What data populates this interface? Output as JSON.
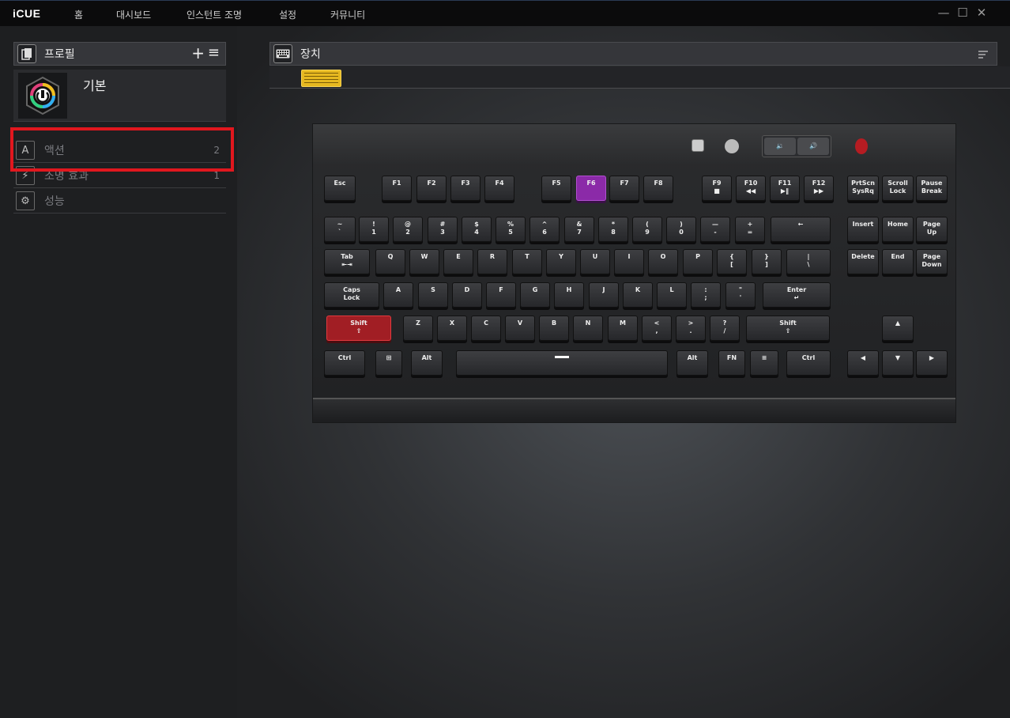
{
  "app": {
    "title": "iCUE"
  },
  "nav": [
    {
      "label": "홈"
    },
    {
      "label": "대시보드"
    },
    {
      "label": "인스턴트 조명"
    },
    {
      "label": "설정"
    },
    {
      "label": "커뮤니티"
    }
  ],
  "window": {
    "minimize": "—",
    "maximize": "☐",
    "close": "✕"
  },
  "profiles": {
    "title": "프로필",
    "add": "+",
    "menu": "≡",
    "active": {
      "name": "기본"
    }
  },
  "sections": [
    {
      "icon": "A",
      "label": "액션",
      "count": "2"
    },
    {
      "icon": "⚡",
      "label": "조명 효과",
      "count": "1"
    },
    {
      "icon": "⚙",
      "label": "성능",
      "count": ""
    }
  ],
  "devices": {
    "title": "장치"
  },
  "keyboard": {
    "rows": [
      [
        "Esc",
        "F1",
        "F2",
        "F3",
        "F4",
        "F5",
        "F6",
        "F7",
        "F8",
        "F9\n■",
        "F10\n◀◀",
        "F11\n▶‖",
        "F12\n▶▶",
        "PrtScn\nSysRq",
        "Scroll\nLock",
        "Pause\nBreak"
      ],
      [
        "~\n`",
        "!\n1",
        "@\n2",
        "#\n3",
        "$\n4",
        "%\n5",
        "^\n6",
        "&\n7",
        "*\n8",
        "(\n9",
        ")\n0",
        "—\n-",
        "+\n=",
        "←",
        "Insert",
        "Home",
        "Page\nUp"
      ],
      [
        "Tab\n⇤⇥",
        "Q",
        "W",
        "E",
        "R",
        "T",
        "Y",
        "U",
        "I",
        "O",
        "P",
        "{\n[",
        "}\n]",
        "|\n\\",
        "Delete",
        "End",
        "Page\nDown"
      ],
      [
        "Caps\nLock",
        "A",
        "S",
        "D",
        "F",
        "G",
        "H",
        "J",
        "K",
        "L",
        ":\n;",
        "\"\n'",
        "Enter\n↵"
      ],
      [
        "Shift\n⇧",
        "Z",
        "X",
        "C",
        "V",
        "B",
        "N",
        "M",
        "<\n,",
        ">\n.",
        "?\n/",
        "Shift\n⇧",
        "▲"
      ],
      [
        "Ctrl",
        "⊞",
        "Alt",
        "",
        "Alt",
        "FN",
        "≡",
        "Ctrl",
        "◀",
        "▼",
        "▶"
      ]
    ],
    "highlighted_keys": {
      "red": "Shift",
      "purple": "F6"
    }
  },
  "colors": {
    "highlight": "#e1171e",
    "accent_purple": "#8b2aa8",
    "accent_red": "#a11e24"
  }
}
